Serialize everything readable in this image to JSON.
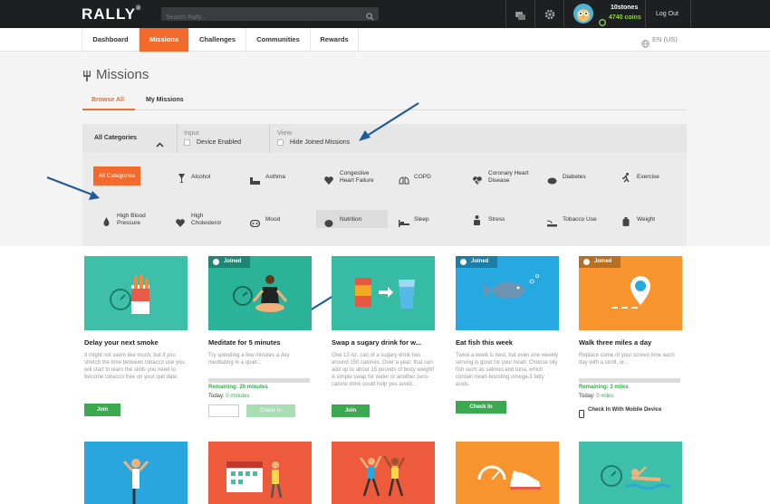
{
  "header": {
    "logo": "RALLY",
    "search_placeholder": "Search Rally...",
    "username": "10stones",
    "coins": "4740 coins",
    "logout": "Log Out",
    "icons": [
      "search-icon",
      "chat-icon",
      "gear-icon",
      "coin-icon"
    ]
  },
  "nav": {
    "tabs": [
      "Dashboard",
      "Missions",
      "Challenges",
      "Communities",
      "Rewards"
    ],
    "active": "Missions",
    "language": "EN (US)"
  },
  "page": {
    "title": "Missions",
    "subtabs": [
      "Browse All",
      "My Missions"
    ],
    "active_subtab": "Browse All"
  },
  "filters": {
    "category_select": "All Categories",
    "input_heading": "Input",
    "device_enabled": "Device Enabled",
    "view_heading": "View",
    "hide_joined": "Hide Joined Missions"
  },
  "categories": [
    "All Categories",
    "Alcohol",
    "Asthma",
    "Congestive Heart Failure",
    "COPD",
    "Coronary Heart Disease",
    "Diabetes",
    "Exercise",
    "High Blood Pressure",
    "High Cholesterol",
    "Mood",
    "Nutrition",
    "Sleep",
    "Stress",
    "Tobacco Use",
    "Weight"
  ],
  "active_category": "All Categories",
  "missions": [
    {
      "title": "Delay your next smoke",
      "desc": "It might not seem like much, but if you stretch the time between tobacco use you will start to learn the skills you need to become tobacco free on your quit date.",
      "joined": false,
      "button": "Join",
      "color": "#3dbfa9"
    },
    {
      "title": "Meditate for 5 minutes",
      "desc": "Try spending a few minutes a day meditating in a quiet...",
      "joined": true,
      "joined_label": "Joined",
      "remaining": "Remaining: 20 minutes",
      "today_label": "Today:",
      "today_value": "0 minutes",
      "button": "Check In",
      "color": "#2bb39a"
    },
    {
      "title": "Swap a sugary drink for w...",
      "desc": "One 12-oz. can of a sugary drink has around 150 calories. Over a year, that can add up to about 15 pounds of body weight! A simple swap for water or another zero-calorie drink could help you avoid...",
      "joined": false,
      "button": "Join",
      "color": "#36bca5"
    },
    {
      "title": "Eat fish this week",
      "desc": "Twice a week is best, but even one weekly serving is good for your heart. Choose oily fish such as salmon and tuna, which contain heart-boosting omega-3 fatty acids.",
      "joined": true,
      "joined_label": "Joined",
      "button": "Check In",
      "color": "#25a9e0"
    },
    {
      "title": "Walk three miles a day",
      "desc": "Replace some of your screen time each day with a stroll, or...",
      "joined": true,
      "joined_label": "Joined",
      "remaining": "Remaining: 3 miles",
      "today_label": "Today:",
      "today_value": "0 miles",
      "mobile": "Check In With Mobile Device",
      "color": "#f7942e"
    }
  ],
  "tiles": [
    "#2aa6de",
    "#ee5a3c",
    "#ee5a3c",
    "#f7942e",
    "#3dbfa9"
  ]
}
